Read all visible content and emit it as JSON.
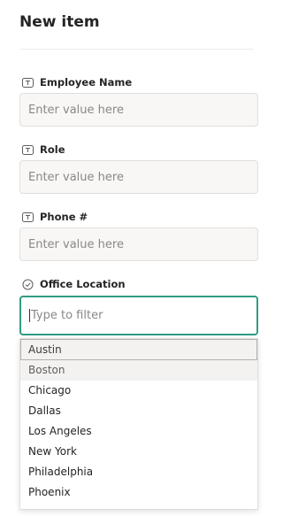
{
  "form": {
    "title": "New item",
    "fields": [
      {
        "label": "Employee Name",
        "placeholder": "Enter value here",
        "icon": "text-field-icon"
      },
      {
        "label": "Role",
        "placeholder": "Enter value here",
        "icon": "text-field-icon"
      },
      {
        "label": "Phone #",
        "placeholder": "Enter value here",
        "icon": "text-field-icon"
      },
      {
        "label": "Office Location",
        "placeholder": "Type to filter",
        "icon": "choice-check-icon"
      }
    ]
  },
  "dropdown": {
    "options": [
      "Austin",
      "Boston",
      "Chicago",
      "Dallas",
      "Los Angeles",
      "New York",
      "Philadelphia",
      "Phoenix"
    ]
  }
}
